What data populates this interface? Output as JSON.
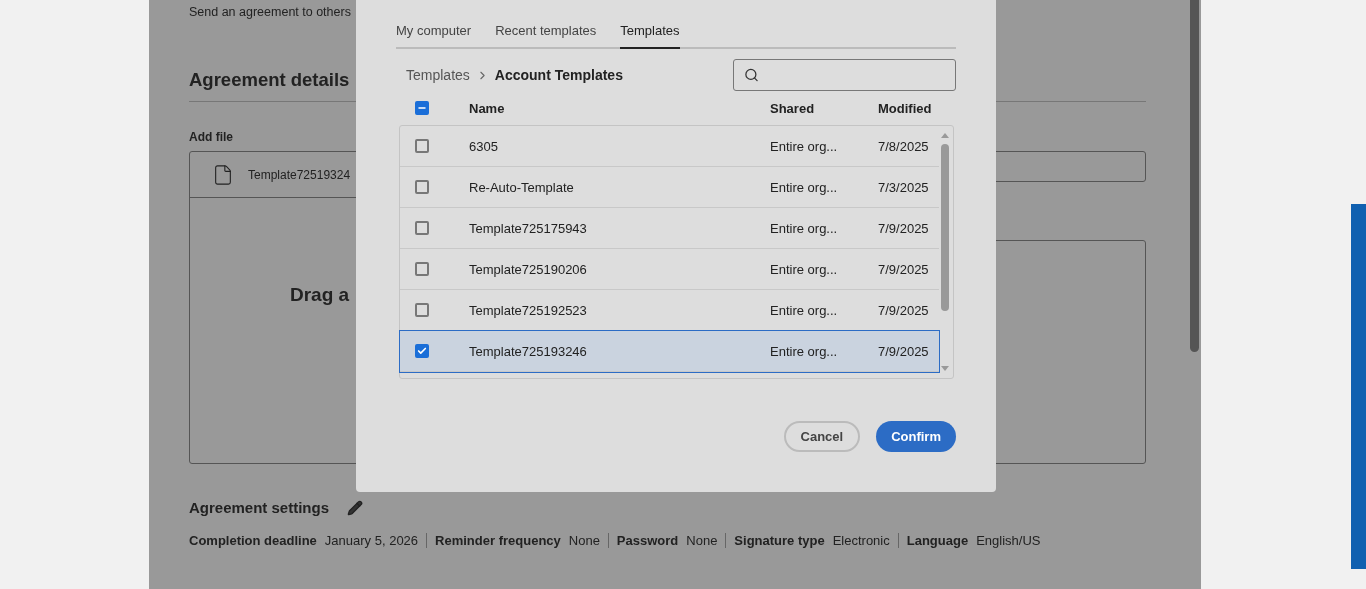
{
  "page": {
    "intro": "Send an agreement to others",
    "details_title": "Agreement details",
    "add_file_label": "Add file",
    "files": [
      {
        "name": "Template72519324"
      }
    ],
    "drop_text": "Drag a",
    "settings_title": "Agreement settings",
    "settings": [
      {
        "label": "Completion deadline",
        "value": "January 5, 2026"
      },
      {
        "label": "Reminder frequency",
        "value": "None"
      },
      {
        "label": "Password",
        "value": "None"
      },
      {
        "label": "Signature type",
        "value": "Electronic"
      },
      {
        "label": "Language",
        "value": "English/US"
      }
    ]
  },
  "dialog": {
    "tabs": [
      {
        "label": "My computer",
        "selected": false
      },
      {
        "label": "Recent templates",
        "selected": false
      },
      {
        "label": "Templates",
        "selected": true
      }
    ],
    "breadcrumb": [
      "Templates",
      "Account Templates"
    ],
    "select_all": {
      "indeterminate": true
    },
    "columns": [
      "Name",
      "Shared",
      "Modified"
    ],
    "rows": [
      {
        "name": "6305",
        "shared": "Entire org...",
        "modified": "7/8/2025",
        "checked": false,
        "selected": false
      },
      {
        "name": "Re-Auto-Template",
        "shared": "Entire org...",
        "modified": "7/3/2025",
        "checked": false,
        "selected": false
      },
      {
        "name": "Template725175943",
        "shared": "Entire org...",
        "modified": "7/9/2025",
        "checked": false,
        "selected": false
      },
      {
        "name": "Template725190206",
        "shared": "Entire org...",
        "modified": "7/9/2025",
        "checked": false,
        "selected": false
      },
      {
        "name": "Template725192523",
        "shared": "Entire org...",
        "modified": "7/9/2025",
        "checked": false,
        "selected": false
      },
      {
        "name": "Template725193246",
        "shared": "Entire org...",
        "modified": "7/9/2025",
        "checked": true,
        "selected": true
      }
    ],
    "buttons": [
      {
        "label": "Cancel",
        "kind": "secondary"
      },
      {
        "label": "Confirm",
        "kind": "primary"
      }
    ]
  }
}
